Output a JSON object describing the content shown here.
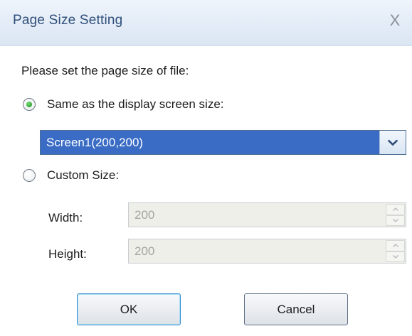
{
  "dialog": {
    "title": "Page Size Setting",
    "close_glyph": "X",
    "prompt": "Please set the page size of file:"
  },
  "options": {
    "same_as_screen": {
      "label": "Same as the display screen size:",
      "checked": true
    },
    "screen_select": {
      "value": "Screen1(200,200)"
    },
    "custom_size": {
      "label": "Custom Size:",
      "checked": false
    }
  },
  "fields": {
    "width": {
      "label": "Width:",
      "value": "200",
      "enabled": false
    },
    "height": {
      "label": "Height:",
      "value": "200",
      "enabled": false
    }
  },
  "buttons": {
    "ok_label": "OK",
    "cancel_label": "Cancel"
  },
  "icons": {
    "close": "close-icon",
    "dropdown": "chevron-down-icon",
    "spin_up": "spin-up-icon",
    "spin_down": "spin-down-icon"
  },
  "colors": {
    "title_text": "#2f4f7a",
    "selection_bg": "#3a6cc6",
    "radio_dot": "#2fa12f",
    "disabled_field_bg": "#efefe9"
  }
}
